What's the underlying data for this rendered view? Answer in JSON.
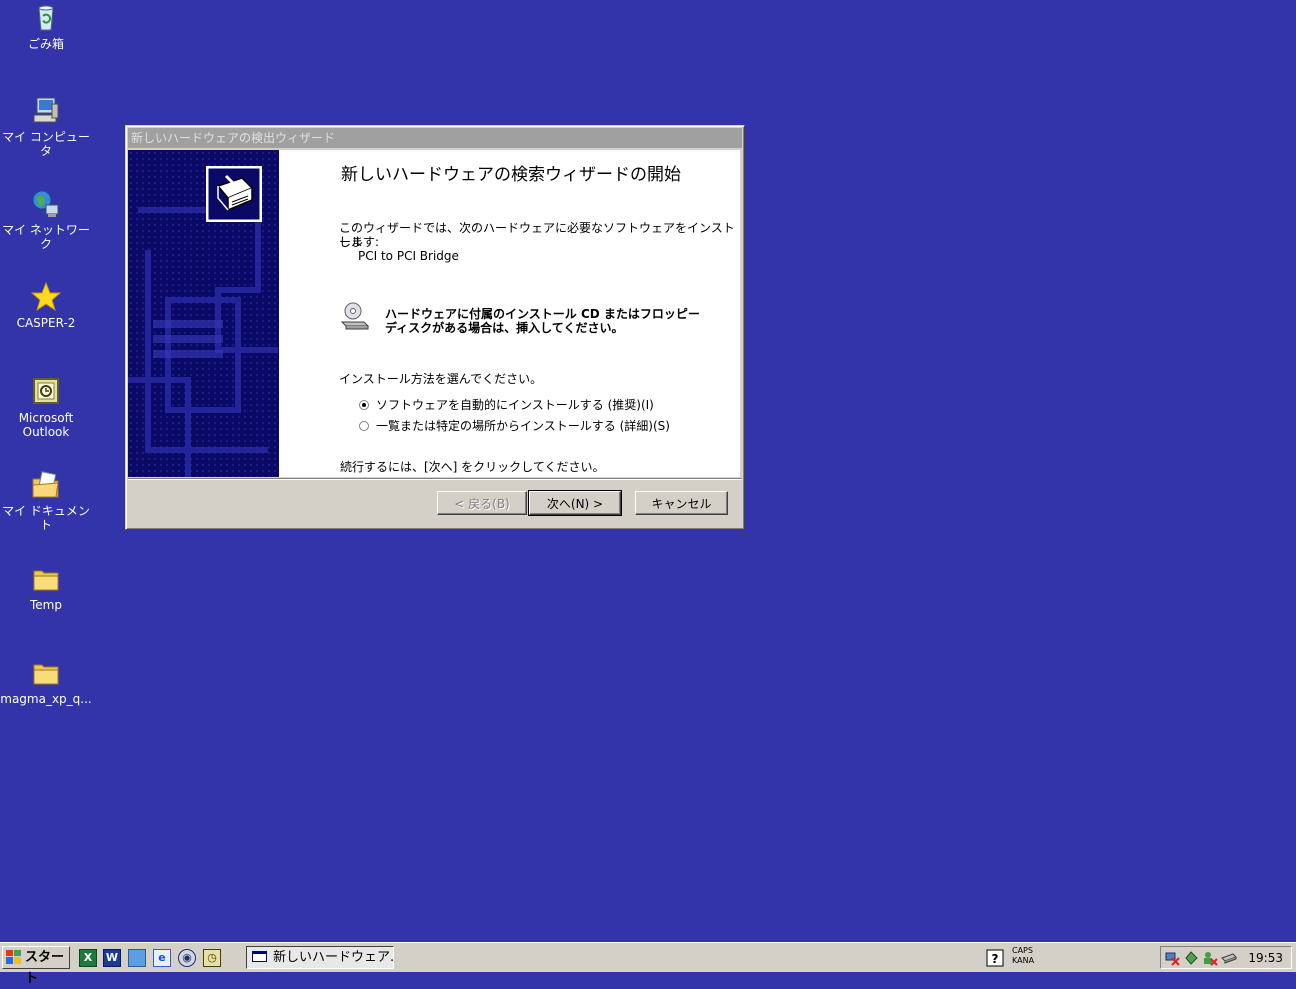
{
  "desktop": {
    "icons": [
      {
        "label": "ごみ箱",
        "icon": "recycle-bin-icon"
      },
      {
        "label": "マイ コンピュータ",
        "icon": "my-computer-icon"
      },
      {
        "label": "マイ ネットワーク",
        "icon": "my-network-icon"
      },
      {
        "label": "CASPER-2",
        "icon": "star-icon"
      },
      {
        "label": "Microsoft Outlook",
        "icon": "outlook-icon"
      },
      {
        "label": "マイ ドキュメント",
        "icon": "my-documents-icon"
      },
      {
        "label": "Temp",
        "icon": "folder-icon"
      },
      {
        "label": "magma_xp_q...",
        "icon": "folder-icon"
      }
    ]
  },
  "dialog": {
    "window_title": "新しいハードウェアの検出ウィザード",
    "heading": "新しいハードウェアの検索ウィザードの開始",
    "intro_line1": "このウィザードでは、次のハードウェアに必要なソフトウェアをインストール",
    "intro_line2": "します:",
    "device_name": "PCI to PCI Bridge",
    "cd_line1": "ハードウェアに付属のインストール CD またはフロッピー",
    "cd_line2": "ディスクがある場合は、挿入してください。",
    "choose_prompt": "インストール方法を選んでください。",
    "options": [
      {
        "label": "ソフトウェアを自動的にインストールする (推奨)(I)",
        "selected": true
      },
      {
        "label": "一覧または特定の場所からインストールする (詳細)(S)",
        "selected": false
      }
    ],
    "continue_text": "続行するには、[次へ] をクリックしてください。",
    "buttons": {
      "back": "< 戻る(B)",
      "next": "次へ(N) >",
      "cancel": "キャンセル"
    }
  },
  "taskbar": {
    "start_label": "スタート",
    "quick_launch": [
      "excel-icon",
      "word-icon",
      "notepad-icon",
      "ie-icon",
      "outlook-express-icon",
      "clock-app-icon"
    ],
    "active_task": "新しいハードウェア...",
    "ime": {
      "caps": "CAPS",
      "kana": "KANA"
    },
    "clock": "19:53"
  },
  "colors": {
    "desktop": "#3333aa",
    "dialog_face": "#d4d0c8",
    "wizard_banner": "#0a0a66"
  }
}
